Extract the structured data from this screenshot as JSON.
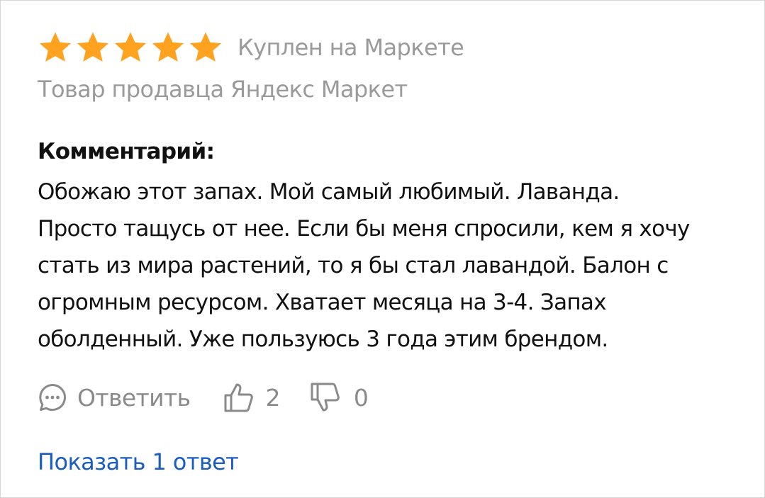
{
  "review": {
    "rating": 5,
    "rating_max": 5,
    "star_color": "#FFA21F",
    "bought_label": "Куплен на Маркете",
    "seller_label": "Товар продавца Яндекс Маркет",
    "comment_title": "Комментарий:",
    "comment_lines": [
      "Обожаю этот запах. Мой самый любимый. Лаванда.",
      "Просто тащусь от нее. Если бы меня спросили, кем я хочу",
      "стать из мира растений, то я бы стал лавандой. Балон с",
      "огромным ресурсом. Хватает месяца на 3-4. Запах",
      "оболденный. Уже пользуюсь 3 года этим брендом."
    ]
  },
  "actions": {
    "reply_label": "Ответить",
    "likes_count": "2",
    "dislikes_count": "0",
    "icons": [
      "comment-icon",
      "thumbs-up-icon",
      "thumbs-down-icon"
    ]
  },
  "replies": {
    "show_label": "Показать 1 ответ",
    "link_color": "#1A5CBF"
  }
}
